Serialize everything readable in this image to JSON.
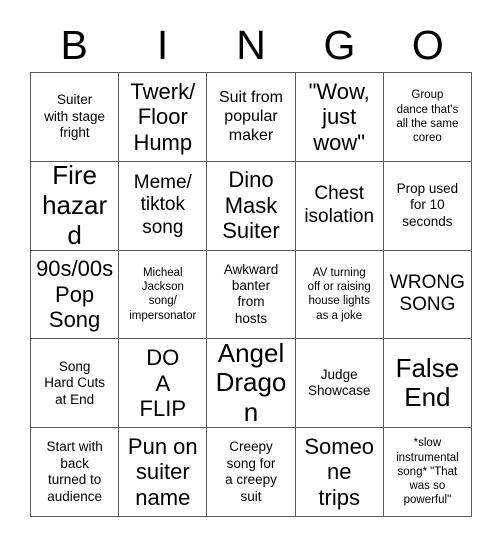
{
  "card": {
    "header_letters": [
      "B",
      "I",
      "N",
      "G",
      "O"
    ],
    "columns": 5,
    "rows": 5,
    "border_color": "#5a5a5a",
    "background_color": "#ffffff",
    "text_color": "#000000",
    "cells": [
      {
        "text": "Suiter\nwith stage\nfright",
        "size": "sm"
      },
      {
        "text": "Twerk/\nFloor\nHump",
        "size": "xl"
      },
      {
        "text": "Suit from\npopular\nmaker",
        "size": "md"
      },
      {
        "text": "\"Wow,\njust\nwow\"",
        "size": "xl"
      },
      {
        "text": "Group\ndance that's\nall the same\ncoreo",
        "size": "xs"
      },
      {
        "text": "Fire\nhazard",
        "size": "xxl"
      },
      {
        "text": "Meme/\ntiktok\nsong",
        "size": "lg"
      },
      {
        "text": "Dino\nMask\nSuiter",
        "size": "xl"
      },
      {
        "text": "Chest\nisolation",
        "size": "lg"
      },
      {
        "text": "Prop used\nfor 10\nseconds",
        "size": "sm"
      },
      {
        "text": "90s/00s\nPop\nSong",
        "size": "xl"
      },
      {
        "text": "Micheal\nJackson\nsong/\nimpersonator",
        "size": "xs"
      },
      {
        "text": "Awkward\nbanter\nfrom\nhosts",
        "size": "sm"
      },
      {
        "text": "AV turning\noff or raising\nhouse lights\nas a joke",
        "size": "xs"
      },
      {
        "text": "WRONG\nSONG",
        "size": "lg"
      },
      {
        "text": "Song\nHard Cuts\nat End",
        "size": "sm"
      },
      {
        "text": "DO\nA\nFLIP",
        "size": "xl"
      },
      {
        "text": "Angel\nDragon",
        "size": "xxl"
      },
      {
        "text": "Judge\nShowcase",
        "size": "sm"
      },
      {
        "text": "False\nEnd",
        "size": "xxl"
      },
      {
        "text": "Start with\nback\nturned to\naudience",
        "size": "sm"
      },
      {
        "text": "Pun on\nsuiter\nname",
        "size": "xl"
      },
      {
        "text": "Creepy\nsong for\na creepy\nsuit",
        "size": "sm"
      },
      {
        "text": "Someone\ntrips",
        "size": "xl"
      },
      {
        "text": "*slow\ninstrumental\nsong* \"That\nwas so\npowerful\"",
        "size": "xs"
      }
    ]
  }
}
